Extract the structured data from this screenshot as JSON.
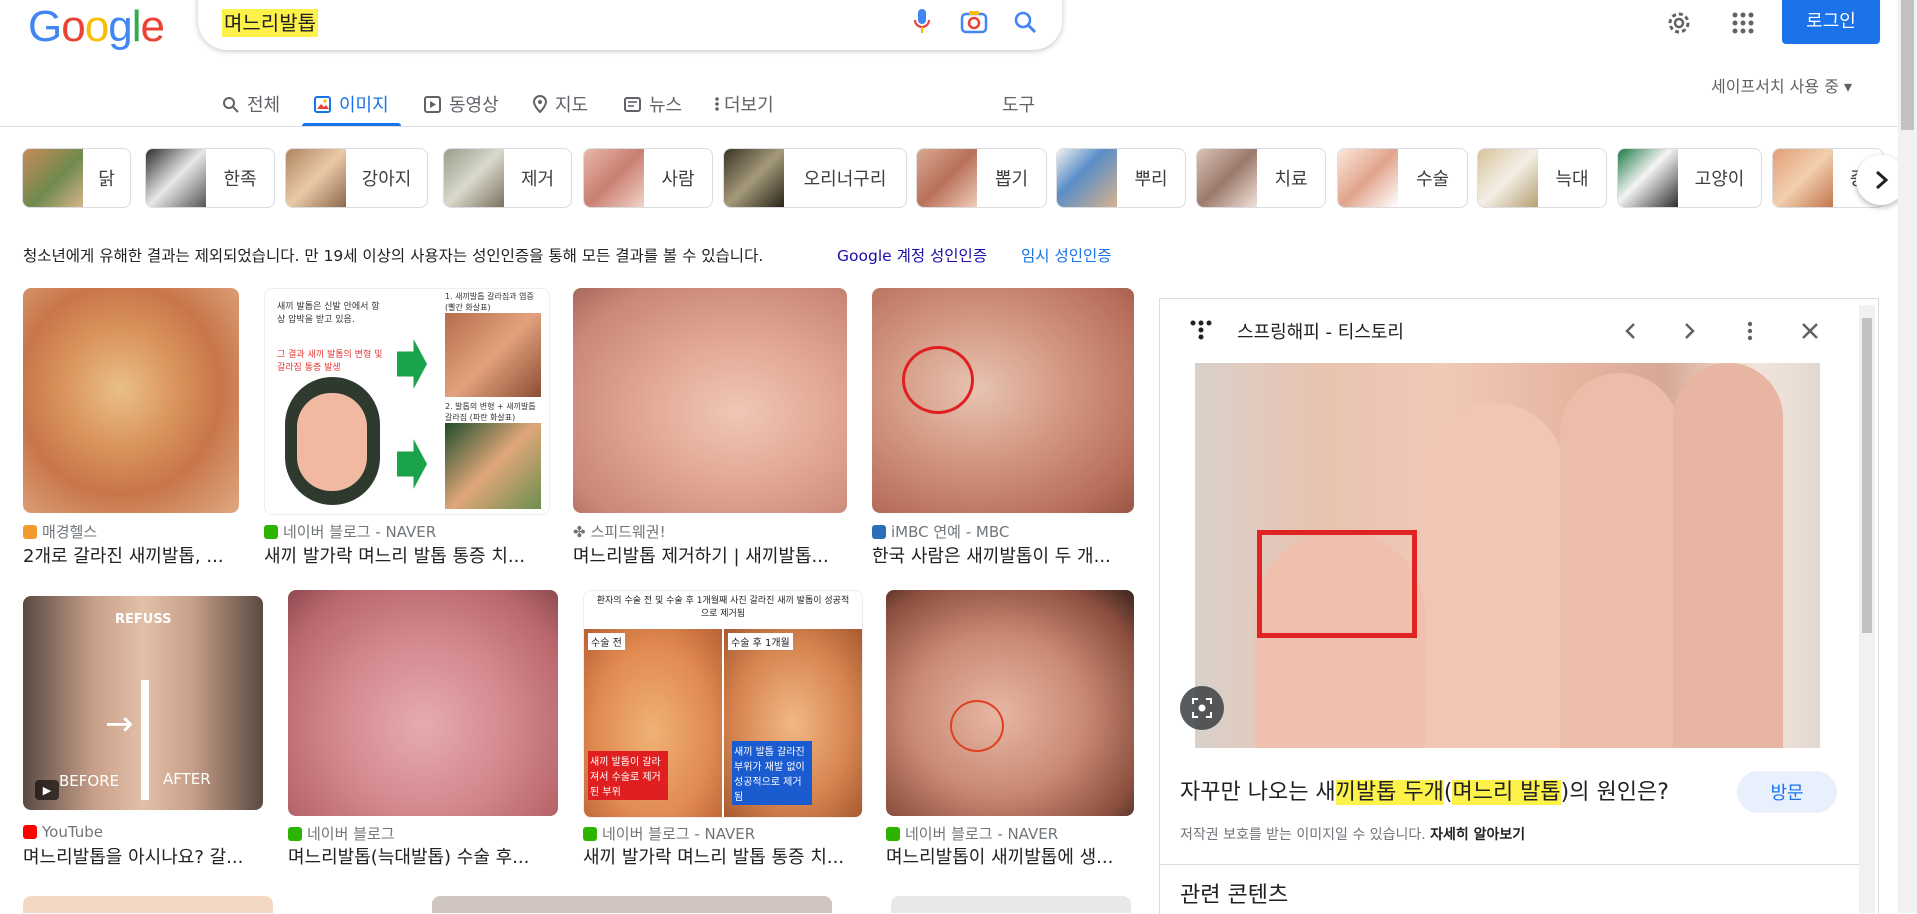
{
  "header": {
    "logo": "Google",
    "search_query": "며느리발톱",
    "login_label": "로그인"
  },
  "tabs": [
    {
      "label": "전체",
      "icon": "search-icon"
    },
    {
      "label": "이미지",
      "icon": "image-icon"
    },
    {
      "label": "동영상",
      "icon": "video-icon"
    },
    {
      "label": "지도",
      "icon": "map-pin-icon"
    },
    {
      "label": "뉴스",
      "icon": "news-icon"
    },
    {
      "label": "더보기",
      "icon": "more-icon"
    },
    {
      "label": "도구",
      "icon": ""
    }
  ],
  "safesearch_label": "세이프서치 사용 중",
  "chips": [
    "닭",
    "한족",
    "강아지",
    "제거",
    "사람",
    "오리너구리",
    "뽑기",
    "뿌리",
    "치료",
    "수술",
    "늑대",
    "고양이",
    "증"
  ],
  "notice": {
    "text": "청소년에게 유해한 결과는 제외되었습니다. 만 19세 이상의 사용자는 성인인증을 통해 모든 결과를 볼 수 있습니다.",
    "link_account": "Google 계정 성인인증",
    "link_temp": "임시 성인인증"
  },
  "results": [
    {
      "source": "매경헬스",
      "title": "2개로 갈라진 새끼발톱, ..."
    },
    {
      "source": "네이버 블로그 - NAVER",
      "title": "새끼 발가락 며느리 발톱 통증 치..."
    },
    {
      "source": "스피드웨권!",
      "title": "며느리발톱 제거하기 | 새끼발톱..."
    },
    {
      "source": "iMBC 연예 - MBC",
      "title": "한국 사람은 새끼발톱이 두 개..."
    },
    {
      "source": "YouTube",
      "title": "며느리발톱을 아시나요? 갈..."
    },
    {
      "source": "네이버 블로그",
      "title": "며느리발톱(늑대발톱) 수술 후..."
    },
    {
      "source": "네이버 블로그 - NAVER",
      "title": "새끼 발가락 며느리 발톱 통증 치..."
    },
    {
      "source": "네이버 블로그 - NAVER",
      "title": "며느리발톱이 새끼발톱에 생..."
    }
  ],
  "image_text": {
    "r2_top": "새끼 발톱은 신발 안에서 항상 압박을 받고 있음.",
    "r2_red": "그 결과 새끼 발톱의 변형 및 갈라짐 통증 발생",
    "r2_cap1": "1. 새끼발톱 갈라짐과 염증 (빨간 화살표)",
    "r2_cap2": "2. 발톱의 변형 + 새끼발톱 갈라짐 (파란 화살표)",
    "r5_brand": "REFUSS",
    "r5_before": "BEFORE",
    "r5_after": "AFTER",
    "r7_head": "환자의 수술 전 및 수술 후 1개월째 사진 갈라진 새끼 발톱이 성공적으로 제거됨",
    "r7_pre": "수술 전",
    "r7_post": "수술 후 1개월",
    "r7_red": "새끼 발톱이 갈라져서 수술로 제거된 부위",
    "r7_blue": "새끼 발톱 갈라진 부위가 재발 없이 성공적으로 제거됨"
  },
  "panel": {
    "site_name": "스프링해피 - 티스토리",
    "title_pre": "자꾸만 나오는 새",
    "title_hl1": "끼발톱 두개",
    "title_mid": "(",
    "title_hl2": "며느리 발톱",
    "title_post": ")의 원인은?",
    "visit_label": "방문",
    "copyright": "저작권 보호를 받는 이미지일 수 있습니다.",
    "learn_more": "자세히 알아보기",
    "related": "관련 콘텐츠"
  },
  "colors": {
    "accent": "#1a73e8",
    "highlight": "#fdf24a",
    "link": "#1a0dab"
  }
}
